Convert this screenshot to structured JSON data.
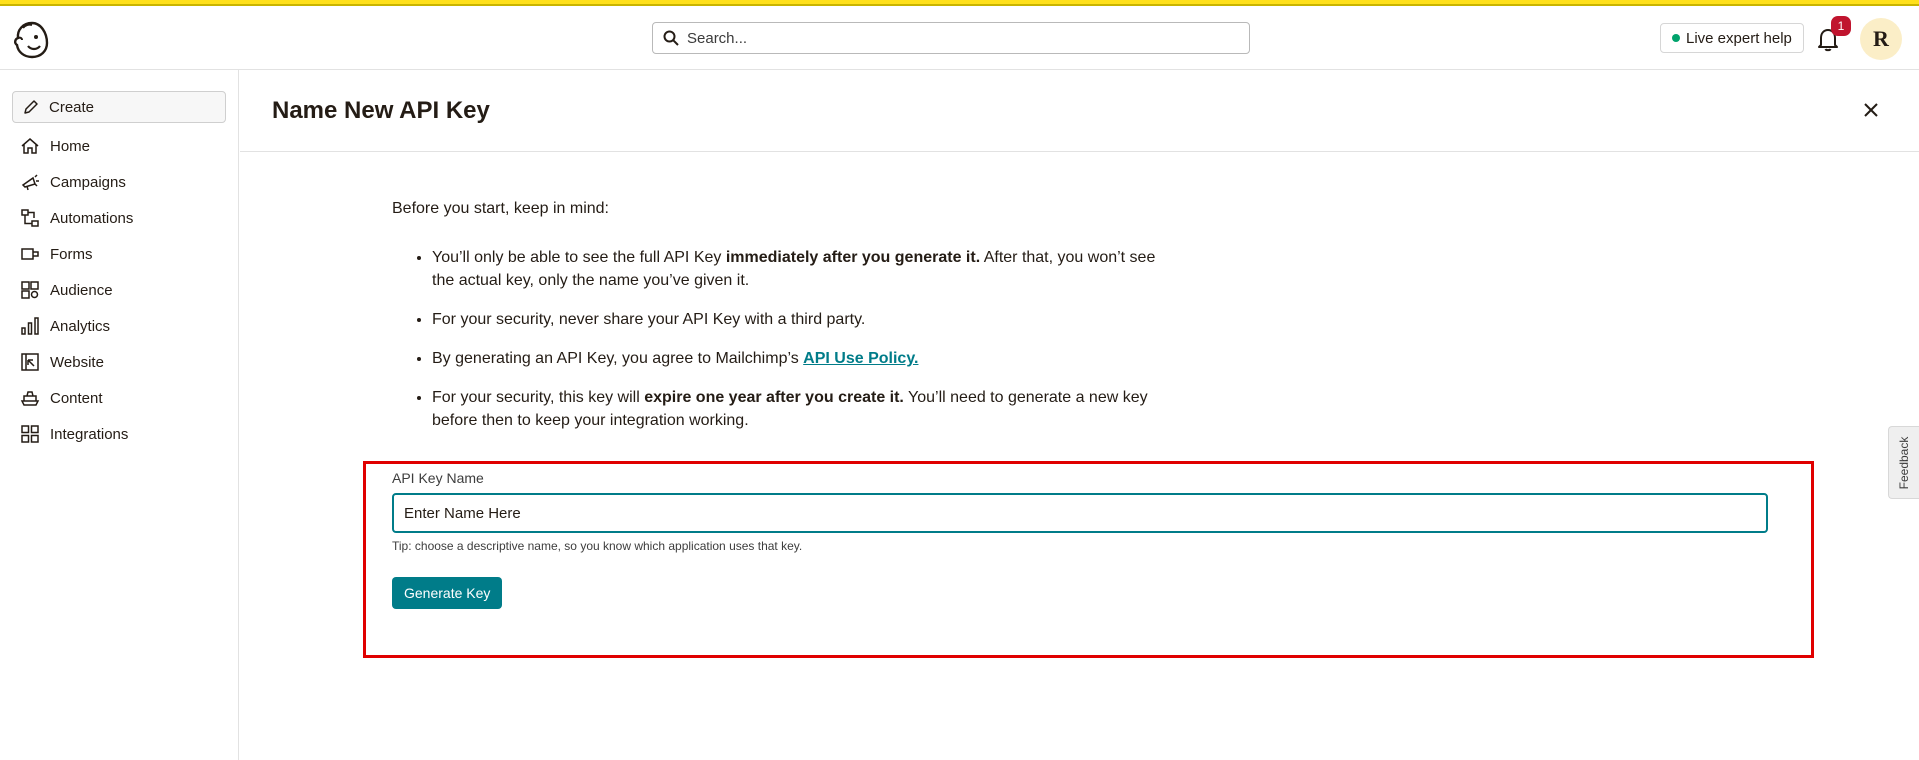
{
  "header": {
    "logo_icon": "mailchimp-freddie-logo",
    "search_placeholder": "Search...",
    "live_help_label": "Live expert help",
    "notification_count": "1",
    "avatar_initial": "R"
  },
  "sidebar": {
    "create_label": "Create",
    "items": [
      {
        "label": "Home",
        "icon": "home-icon"
      },
      {
        "label": "Campaigns",
        "icon": "campaigns-icon"
      },
      {
        "label": "Automations",
        "icon": "automations-icon"
      },
      {
        "label": "Forms",
        "icon": "forms-icon"
      },
      {
        "label": "Audience",
        "icon": "audience-icon"
      },
      {
        "label": "Analytics",
        "icon": "analytics-icon"
      },
      {
        "label": "Website",
        "icon": "website-icon"
      },
      {
        "label": "Content",
        "icon": "content-icon"
      },
      {
        "label": "Integrations",
        "icon": "integrations-icon"
      }
    ]
  },
  "panel": {
    "title": "Name New API Key",
    "intro": "Before you start, keep in mind:",
    "bullet1_a": "You’ll only be able to see the full API Key ",
    "bullet1_b": "immediately after you generate it.",
    "bullet1_c": " After that, you won’t see the actual key, only the name you’ve given it.",
    "bullet2": "For your security, never share your API Key with a third party.",
    "bullet3_a": "By generating an API Key, you agree to Mailchimp’s ",
    "bullet3_link": "API Use Policy.",
    "bullet4_a": "For your security, this key will ",
    "bullet4_b": "expire one year after you create it.",
    "bullet4_c": " You’ll need to generate a new key before then to keep your integration working.",
    "field_label": "API Key Name",
    "field_placeholder": "Enter Name Here",
    "field_value": "",
    "tip": "Tip: choose a descriptive name, so you know which application uses that key.",
    "generate_label": "Generate Key"
  },
  "feedback_label": "Feedback",
  "colors": {
    "accent": "#007c89",
    "highlight_border": "#e00000",
    "badge": "#c0142e",
    "brand_yellow": "#ffe01b"
  }
}
